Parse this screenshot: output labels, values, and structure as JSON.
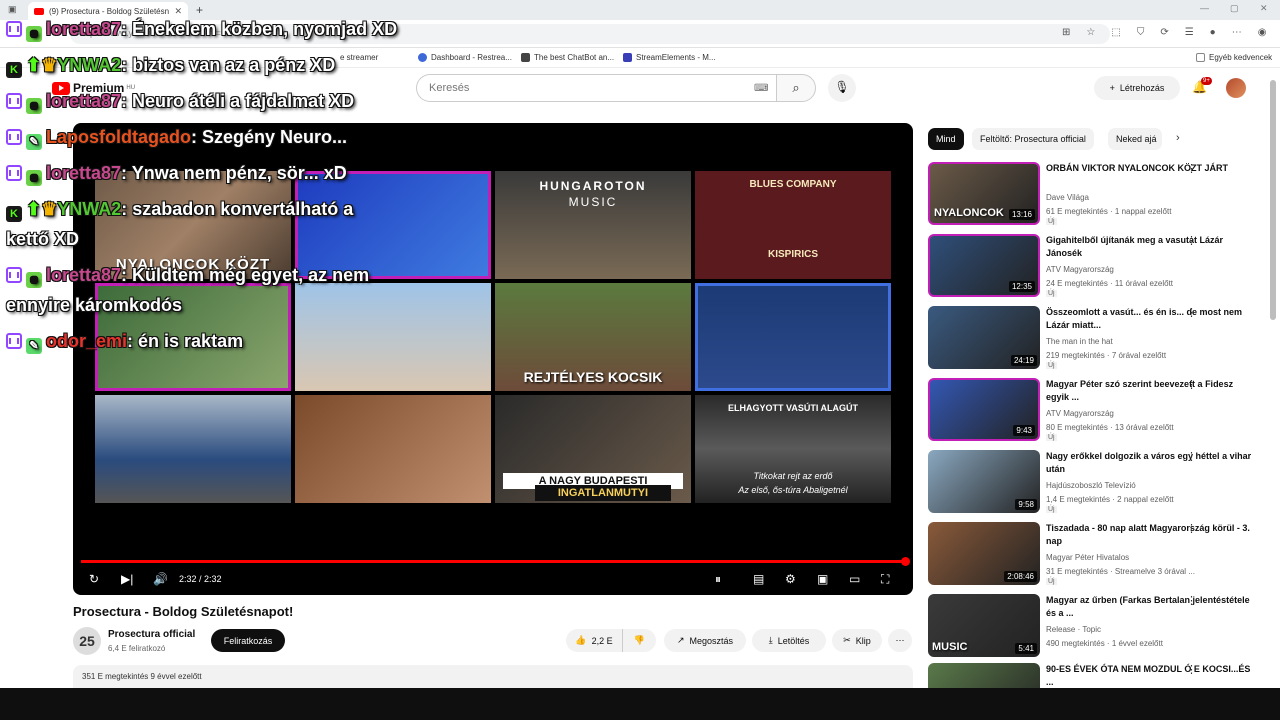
{
  "browser": {
    "tab_title": "(9) Prosectura - Boldog Születésn",
    "url": "https://www.youtube.com/watch?v=..."
  },
  "bookmarks": [
    {
      "label": "Dashboard - Restrea...",
      "color": "#3d68d8"
    },
    {
      "label": "The best ChatBot an...",
      "color": "#444444"
    },
    {
      "label": "StreamElements - M...",
      "color": "#3b3fb7"
    },
    {
      "label": "Egyéb kedvencek",
      "color": "#888888"
    }
  ],
  "bookmark_partial": "e streamer",
  "youtube": {
    "logo_text": "Premium",
    "logo_region": "HU",
    "search_placeholder": "Keresés",
    "create_label": "Létrehozás",
    "notif_count": "9+"
  },
  "player": {
    "time": "2:32 / 2:32",
    "progress": 1.0
  },
  "tiles": {
    "t1": "NYALONCOK KÖZT",
    "t5": "HUNGAROTON",
    "t5b": "MUSIC",
    "t6a": "BLUES COMPANY",
    "t6b": "KISPIRICS",
    "t7": "REJTÉLYES KOCSIK",
    "t11a": "A NAGY BUDAPESTI",
    "t11b": "INGATLANMUTYI",
    "t12a": "ELHAGYOTT VASÚTI ALAGÚT",
    "t12b": "Titkokat rejt az erdő",
    "t12c": "Az első, ős-túra Abaligetnél"
  },
  "chat": [
    {
      "user": "loretta87",
      "text": ": Énekelem közben, nyomjad XD",
      "color": "#c8488e"
    },
    {
      "user": "YNWA2",
      "text": ": biztos van az a pénz XD",
      "color": "#53c832"
    },
    {
      "user": "loretta87",
      "text": ": Neuro átéli a fájdalmat XD",
      "color": "#c8488e"
    },
    {
      "user": "Laposfoldtagado",
      "text": ": Szegény Neuro...",
      "color": "#e8521f"
    },
    {
      "user": "loretta87",
      "text": ": Ynwa nem pénz, sör... xD",
      "color": "#c8488e"
    },
    {
      "user": "YNWA2",
      "text": ": szabadon konvertálható a",
      "color": "#53c832"
    },
    {
      "cont": "kettő XD"
    },
    {
      "user": "loretta87",
      "text": ": Küldtem még egyet, az nem",
      "color": "#c8488e"
    },
    {
      "cont": "ennyire káromkodós"
    },
    {
      "user": "odor_emi",
      "text": ": én is raktam",
      "color": "#e8332c"
    }
  ],
  "video": {
    "title": "Prosectura - Boldog Születésnapot!",
    "channel": "Prosectura official",
    "channel_initials": "25",
    "subscribers": "6,4 E feliratkozó",
    "subscribe_label": "Feliratkozás",
    "likes": "2,2 E",
    "share_label": "Megosztás",
    "download_label": "Letöltés",
    "clip_label": "Klip",
    "stats": "351 E megtekintés  9 évvel ezelőtt"
  },
  "chips": [
    "Mind",
    "Feltöltő: Prosectura official",
    "Neked ajá"
  ],
  "recommendations": [
    {
      "title": "ORBÁN VIKTOR NYALONCOK KÖZT JÁRT",
      "channel": "Dave Világa",
      "meta": "61 E megtekintés · 1 nappal ezelőtt",
      "new": "Új",
      "duration": "13:16",
      "thumb_text": "NYALONCOK",
      "bg": "#6b5a48"
    },
    {
      "title": "Gigahitelből újítanák meg a vasutat Lázár Jánosék",
      "channel": "ATV Magyarország",
      "meta": "24 E megtekintés · 11 órával ezelőtt",
      "new": "Új",
      "duration": "12:35",
      "thumb_text": "",
      "bg": "#2f4f7a"
    },
    {
      "title": "Összeomlott a vasút... és én is... de most nem Lázár miatt...",
      "channel": "The man in the hat",
      "meta": "219 megtekintés · 7 órával ezelőtt",
      "new": "Új",
      "duration": "24:19",
      "thumb_text": "",
      "bg": "#3a5a80"
    },
    {
      "title": "Magyar Péter szó szerint beevezett a Fidesz egyik ...",
      "channel": "ATV Magyarország",
      "meta": "80 E megtekintés · 13 órával ezelőtt",
      "new": "Új",
      "duration": "9:43",
      "thumb_text": "",
      "bg": "#3357b3"
    },
    {
      "title": "Nagy erőkkel dolgozik a város egy héttel a vihar után",
      "channel": "Hajdúszoboszló Televízió",
      "meta": "1,4 E megtekintés · 2 nappal ezelőtt",
      "new": "Új",
      "duration": "9:58",
      "thumb_text": "",
      "bg": "#8aa8c0"
    },
    {
      "title": "Tiszadada - 80 nap alatt Magyarország körül - 3. nap",
      "channel": "Magyar Péter Hivatalos",
      "meta": "31 E megtekintés · Streamelve 3 órával ...",
      "new": "Új",
      "duration": "2:08:46",
      "thumb_text": "",
      "bg": "#8a5a3a"
    },
    {
      "title": "Magyar az űrben (Farkas Bertalan jelentéstétele és a ...",
      "channel": "Release · Topic",
      "meta": "490 megtekintés · 1 évvel ezelőtt",
      "new": "",
      "duration": "5:41",
      "thumb_text": "MUSIC",
      "bg": "#3a3a3a"
    },
    {
      "title": "90-ES ÉVEK ÓTA NEM MOZDUL Ó E KOCSI...ÉS ...",
      "channel": "",
      "meta": "",
      "new": "",
      "duration": "",
      "thumb_text": "",
      "bg": "#5a7a4a"
    }
  ]
}
